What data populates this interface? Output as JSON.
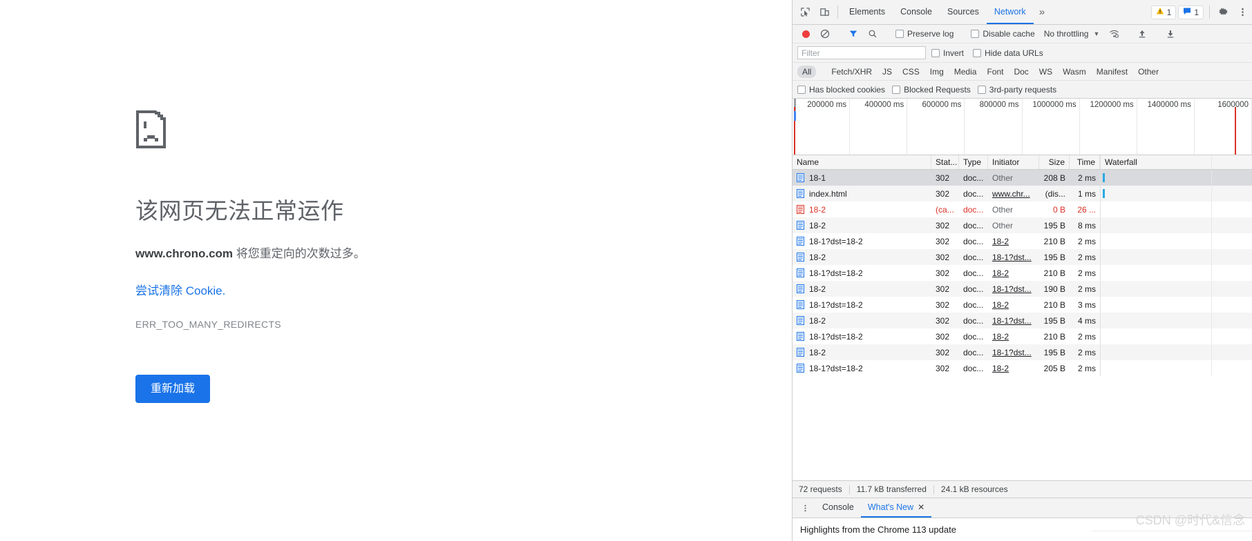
{
  "error_page": {
    "icon": "sad-document-icon",
    "title": "该网页无法正常运作",
    "subject": "www.chrono.com",
    "subject_rest": " 将您重定向的次数过多。",
    "link": "尝试清除 Cookie.",
    "code": "ERR_TOO_MANY_REDIRECTS",
    "reload_label": "重新加载",
    "accent": "#1a73e8"
  },
  "devtools": {
    "tabs": [
      {
        "label": "Elements",
        "active": false
      },
      {
        "label": "Console",
        "active": false
      },
      {
        "label": "Sources",
        "active": false
      },
      {
        "label": "Network",
        "active": true
      }
    ],
    "more_tabs": "»",
    "warning_badge": {
      "icon": "warning-triangle-icon",
      "count": "1"
    },
    "message_badge": {
      "icon": "message-icon",
      "count": "1"
    },
    "settings_icon": "gear-icon",
    "kebab_icon": "more-vertical-icon",
    "inspect_icon": "inspect-cursor-icon",
    "device_icon": "device-toolbar-icon",
    "toolbar": {
      "record_icon": "record-dot-icon",
      "clear_icon": "clear-prohibited-icon",
      "filter_icon": "funnel-icon",
      "search_icon": "magnifier-icon",
      "preserve_log": "Preserve log",
      "disable_cache": "Disable cache",
      "throttling": "No throttling",
      "throttle_caret": "▼",
      "wifi_icon": "network-conditions-icon",
      "import_icon": "upload-arrow-icon",
      "export_icon": "download-arrow-icon"
    },
    "filter": {
      "placeholder": "Filter",
      "value": "",
      "invert": "Invert",
      "hide_data_urls": "Hide data URLs"
    },
    "types": [
      {
        "label": "All",
        "selected": true
      },
      {
        "label": "Fetch/XHR",
        "selected": false
      },
      {
        "label": "JS",
        "selected": false
      },
      {
        "label": "CSS",
        "selected": false
      },
      {
        "label": "Img",
        "selected": false
      },
      {
        "label": "Media",
        "selected": false
      },
      {
        "label": "Font",
        "selected": false
      },
      {
        "label": "Doc",
        "selected": false
      },
      {
        "label": "WS",
        "selected": false
      },
      {
        "label": "Wasm",
        "selected": false
      },
      {
        "label": "Manifest",
        "selected": false
      },
      {
        "label": "Other",
        "selected": false
      }
    ],
    "blocked": {
      "has_blocked_cookies": "Has blocked cookies",
      "blocked_requests": "Blocked Requests",
      "third_party": "3rd-party requests"
    },
    "overview_ticks": [
      "200000 ms",
      "400000 ms",
      "600000 ms",
      "800000 ms",
      "1000000 ms",
      "1200000 ms",
      "1400000 ms",
      "1600000"
    ],
    "table_headers": {
      "name": "Name",
      "status": "Stat...",
      "type": "Type",
      "initiator": "Initiator",
      "size": "Size",
      "time": "Time",
      "waterfall": "Waterfall"
    },
    "requests": [
      {
        "name": "18-1",
        "status": "302",
        "type": "doc...",
        "initiator": "Other",
        "init_link": false,
        "size": "208 B",
        "time": "2 ms",
        "selected": true,
        "error": false,
        "waterfall": true
      },
      {
        "name": "index.html",
        "status": "302",
        "type": "doc...",
        "initiator": "www.chr...",
        "init_link": true,
        "size": "(dis...",
        "time": "1 ms",
        "selected": false,
        "error": false,
        "waterfall": true
      },
      {
        "name": "18-2",
        "status": "(ca...",
        "type": "doc...",
        "initiator": "Other",
        "init_link": false,
        "size": "0 B",
        "time": "26 ...",
        "selected": false,
        "error": true,
        "waterfall": false
      },
      {
        "name": "18-2",
        "status": "302",
        "type": "doc...",
        "initiator": "Other",
        "init_link": false,
        "size": "195 B",
        "time": "8 ms",
        "selected": false,
        "error": false,
        "waterfall": false
      },
      {
        "name": "18-1?dst=18-2",
        "status": "302",
        "type": "doc...",
        "initiator": "18-2",
        "init_link": true,
        "size": "210 B",
        "time": "2 ms",
        "selected": false,
        "error": false,
        "waterfall": false
      },
      {
        "name": "18-2",
        "status": "302",
        "type": "doc...",
        "initiator": "18-1?dst...",
        "init_link": true,
        "size": "195 B",
        "time": "2 ms",
        "selected": false,
        "error": false,
        "waterfall": false
      },
      {
        "name": "18-1?dst=18-2",
        "status": "302",
        "type": "doc...",
        "initiator": "18-2",
        "init_link": true,
        "size": "210 B",
        "time": "2 ms",
        "selected": false,
        "error": false,
        "waterfall": false
      },
      {
        "name": "18-2",
        "status": "302",
        "type": "doc...",
        "initiator": "18-1?dst...",
        "init_link": true,
        "size": "190 B",
        "time": "2 ms",
        "selected": false,
        "error": false,
        "waterfall": false
      },
      {
        "name": "18-1?dst=18-2",
        "status": "302",
        "type": "doc...",
        "initiator": "18-2",
        "init_link": true,
        "size": "210 B",
        "time": "3 ms",
        "selected": false,
        "error": false,
        "waterfall": false
      },
      {
        "name": "18-2",
        "status": "302",
        "type": "doc...",
        "initiator": "18-1?dst...",
        "init_link": true,
        "size": "195 B",
        "time": "4 ms",
        "selected": false,
        "error": false,
        "waterfall": false
      },
      {
        "name": "18-1?dst=18-2",
        "status": "302",
        "type": "doc...",
        "initiator": "18-2",
        "init_link": true,
        "size": "210 B",
        "time": "2 ms",
        "selected": false,
        "error": false,
        "waterfall": false
      },
      {
        "name": "18-2",
        "status": "302",
        "type": "doc...",
        "initiator": "18-1?dst...",
        "init_link": true,
        "size": "195 B",
        "time": "2 ms",
        "selected": false,
        "error": false,
        "waterfall": false
      },
      {
        "name": "18-1?dst=18-2",
        "status": "302",
        "type": "doc...",
        "initiator": "18-2",
        "init_link": true,
        "size": "205 B",
        "time": "2 ms",
        "selected": false,
        "error": false,
        "waterfall": false
      }
    ],
    "summary": {
      "requests": "72 requests",
      "transferred": "11.7 kB transferred",
      "resources": "24.1 kB resources"
    },
    "drawer": {
      "kebab_icon": "more-vertical-icon",
      "tabs": [
        {
          "label": "Console",
          "active": false,
          "closable": false
        },
        {
          "label": "What's New",
          "active": true,
          "closable": true
        }
      ],
      "close_glyph": "✕",
      "content": "Highlights from the Chrome 113 update"
    }
  },
  "watermark": "CSDN @时代&信念"
}
